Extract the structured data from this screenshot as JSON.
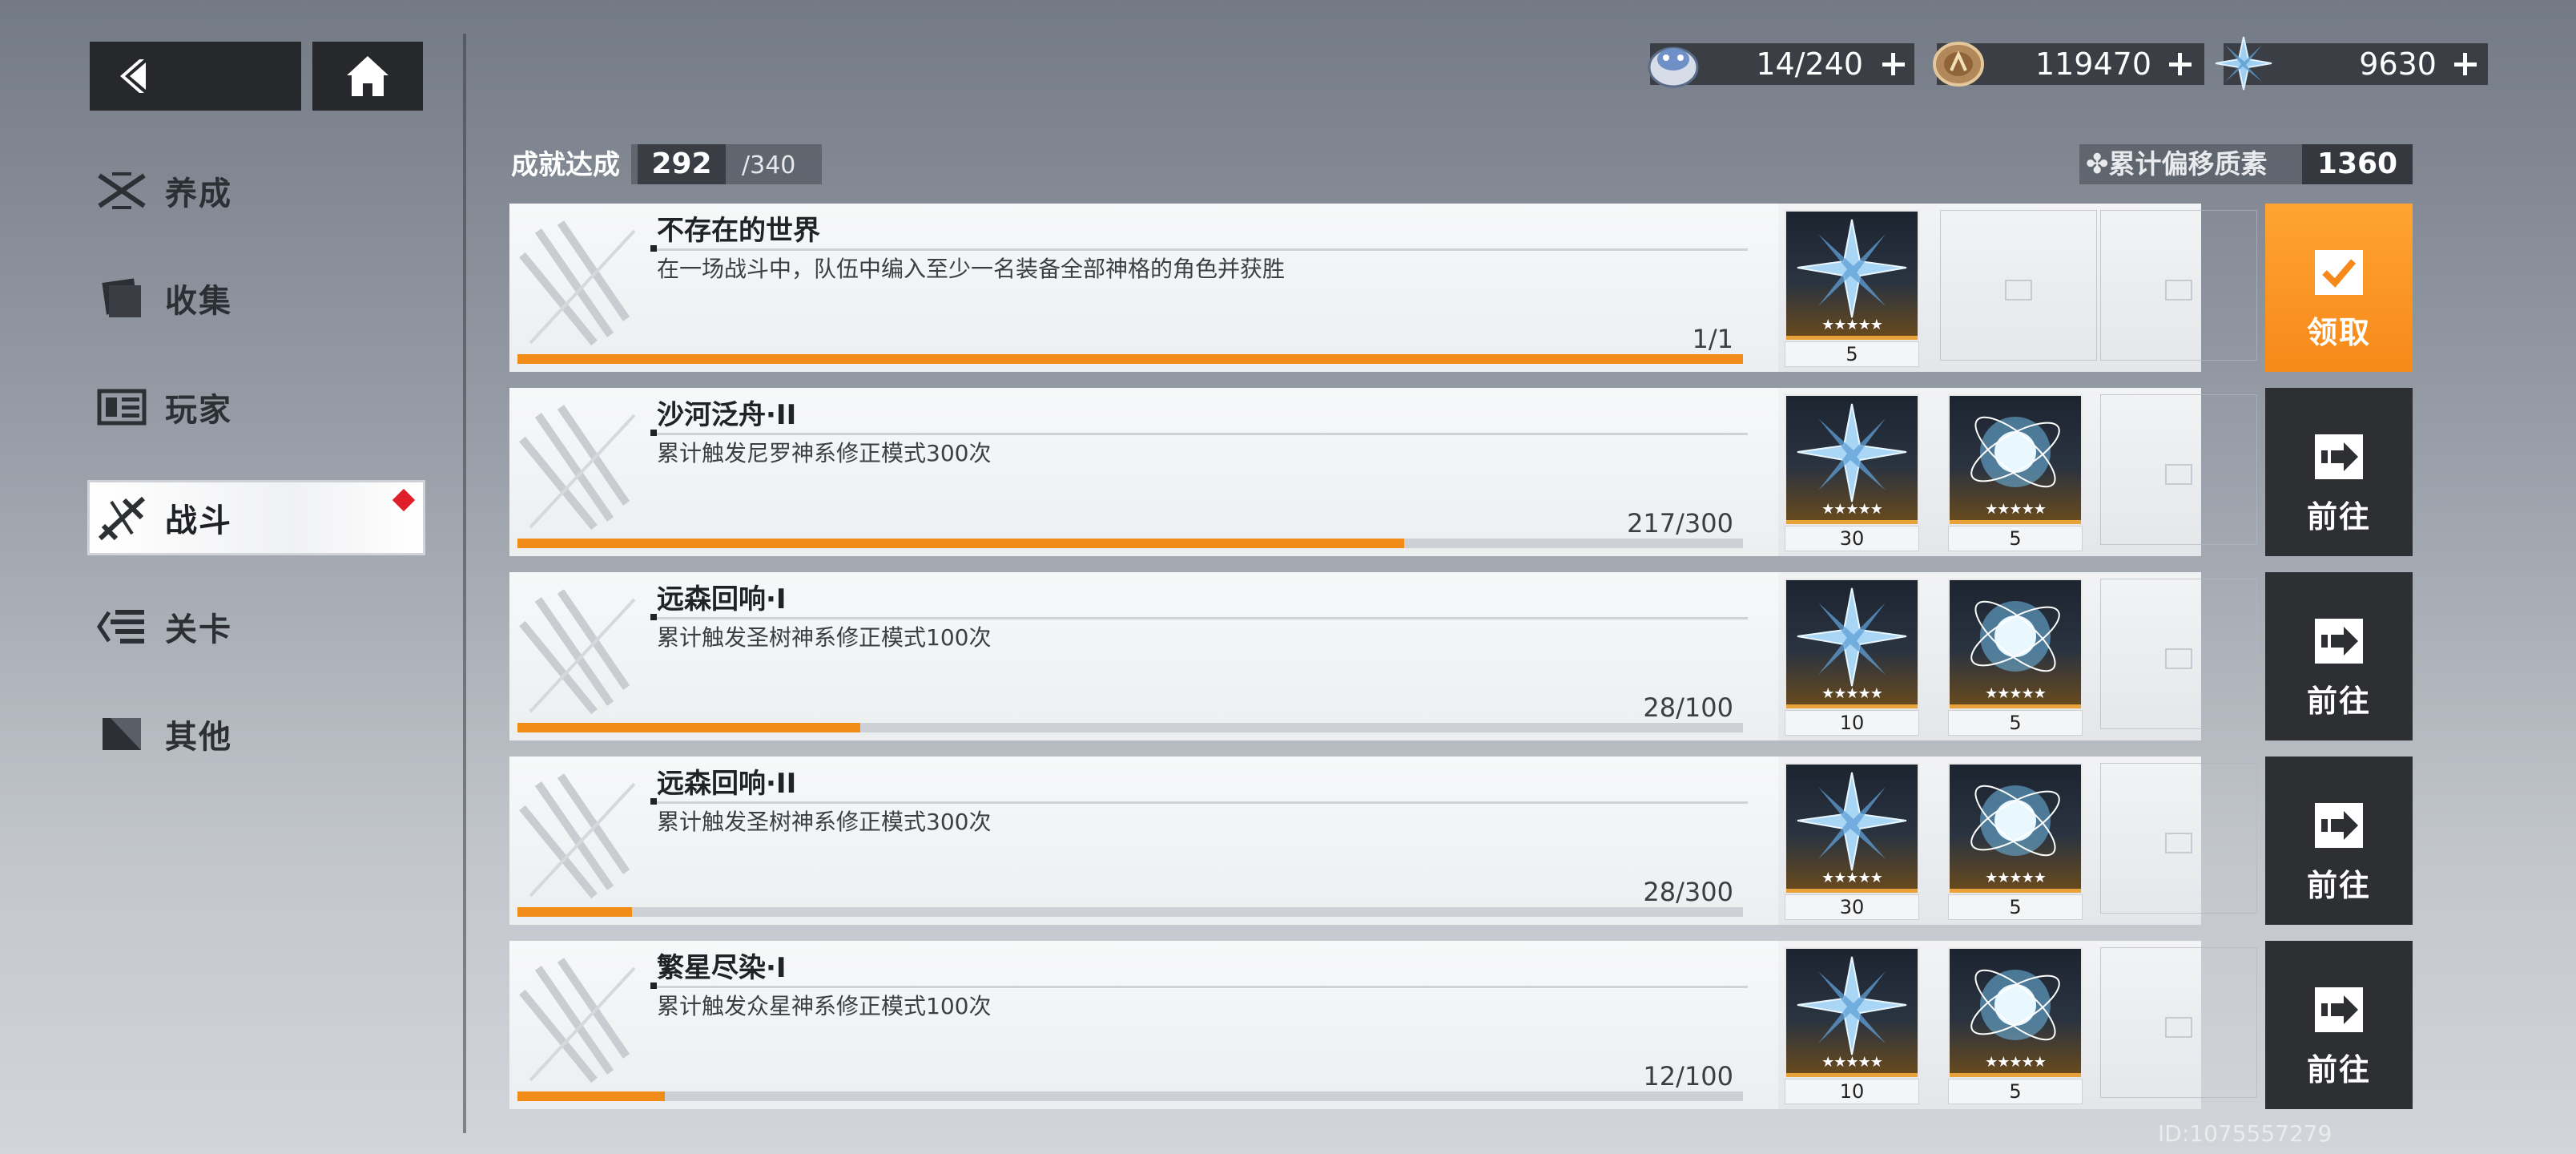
{
  "nav": {
    "back_icon": "back-arrow-icon",
    "home_icon": "home-icon"
  },
  "sidebar": {
    "items": [
      {
        "label": "养成",
        "icon": "crossed-swords-icon",
        "active": false
      },
      {
        "label": "收集",
        "icon": "card-collection-icon",
        "active": false
      },
      {
        "label": "玩家",
        "icon": "player-profile-icon",
        "active": false
      },
      {
        "label": "战斗",
        "icon": "battle-icon",
        "active": true,
        "badge": true
      },
      {
        "label": "关卡",
        "icon": "stage-icon",
        "active": false
      },
      {
        "label": "其他",
        "icon": "other-icon",
        "active": false
      }
    ]
  },
  "resources": {
    "stamina": {
      "value": "14/240",
      "icon": "stamina-icon"
    },
    "coin": {
      "value": "119470",
      "icon": "coin-icon"
    },
    "crystal": {
      "value": "9630",
      "icon": "crystal-icon"
    }
  },
  "summary": {
    "label": "成就达成",
    "count": "292",
    "total": "/340",
    "accum_label": "累计偏移质素",
    "accum_value": "1360"
  },
  "achievements": [
    {
      "title": "不存在的世界",
      "desc": "在一场战斗中，队伍中编入至少一名装备全部神格的角色并获胜",
      "progress_text": "1/1",
      "progress": 1.0,
      "rewards": [
        {
          "qty": "5",
          "kind": "crystal"
        }
      ],
      "action": "领取",
      "action_type": "claim"
    },
    {
      "title": "沙河泛舟·II",
      "desc": "累计触发尼罗神系修正模式300次",
      "progress_text": "217/300",
      "progress": 0.7233,
      "rewards": [
        {
          "qty": "30",
          "kind": "crystal"
        },
        {
          "qty": "5",
          "kind": "orb"
        }
      ],
      "action": "前往",
      "action_type": "go"
    },
    {
      "title": "远森回响·I",
      "desc": "累计触发圣树神系修正模式100次",
      "progress_text": "28/100",
      "progress": 0.28,
      "rewards": [
        {
          "qty": "10",
          "kind": "crystal"
        },
        {
          "qty": "5",
          "kind": "orb"
        }
      ],
      "action": "前往",
      "action_type": "go"
    },
    {
      "title": "远森回响·II",
      "desc": "累计触发圣树神系修正模式300次",
      "progress_text": "28/300",
      "progress": 0.0933,
      "rewards": [
        {
          "qty": "30",
          "kind": "crystal"
        },
        {
          "qty": "5",
          "kind": "orb"
        }
      ],
      "action": "前往",
      "action_type": "go"
    },
    {
      "title": "繁星尽染·I",
      "desc": "累计触发众星神系修正模式100次",
      "progress_text": "12/100",
      "progress": 0.12,
      "rewards": [
        {
          "qty": "10",
          "kind": "crystal"
        },
        {
          "qty": "5",
          "kind": "orb"
        }
      ],
      "action": "前往",
      "action_type": "go"
    }
  ],
  "reward_stars": "★★★★★",
  "footer": {
    "id": "ID:1075557279"
  },
  "colors": {
    "accent": "#f28c18",
    "dark": "#2d2f33",
    "badge": "#e01d2a"
  }
}
